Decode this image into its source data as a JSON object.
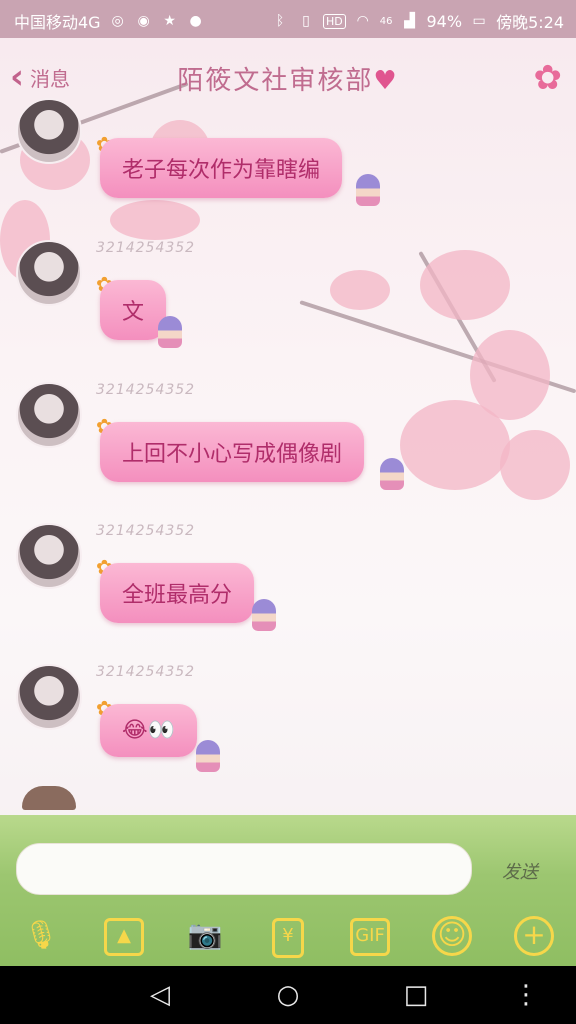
{
  "status_bar": {
    "carrier": "中国移动4G",
    "bluetooth": "bluetooth-icon",
    "vibrate": "vibrate-icon",
    "hd": "HD",
    "wifi": "wifi-icon",
    "signal": "46",
    "battery": "94%",
    "time": "傍晚5:24"
  },
  "header": {
    "back_label": "消息",
    "title": "陌筱文社审核部",
    "title_heart": "♥",
    "menu_icon": "flower-icon"
  },
  "messages": [
    {
      "sender_id": "",
      "text": "老子每次作为靠瞎编"
    },
    {
      "sender_id": "3214254352",
      "text": "文"
    },
    {
      "sender_id": "3214254352",
      "text": "上回不小心写成偶像剧"
    },
    {
      "sender_id": "3214254352",
      "text": "全班最高分"
    },
    {
      "sender_id": "3214254352",
      "text": "😂👀"
    }
  ],
  "input": {
    "placeholder": "",
    "send_label": "发送"
  },
  "toolbar": {
    "items": [
      "mic-icon",
      "image-icon",
      "camera-icon",
      "red-packet-icon",
      "gif-icon",
      "emoji-icon",
      "plus-icon"
    ],
    "gif_label": "GIF",
    "red_packet_glyph": "¥"
  },
  "colors": {
    "status_bar": "#c9a4b2",
    "accent_pink": "#c06c8f",
    "bubble": "#f48fbe",
    "toolbar_icon": "#f6d74a"
  }
}
